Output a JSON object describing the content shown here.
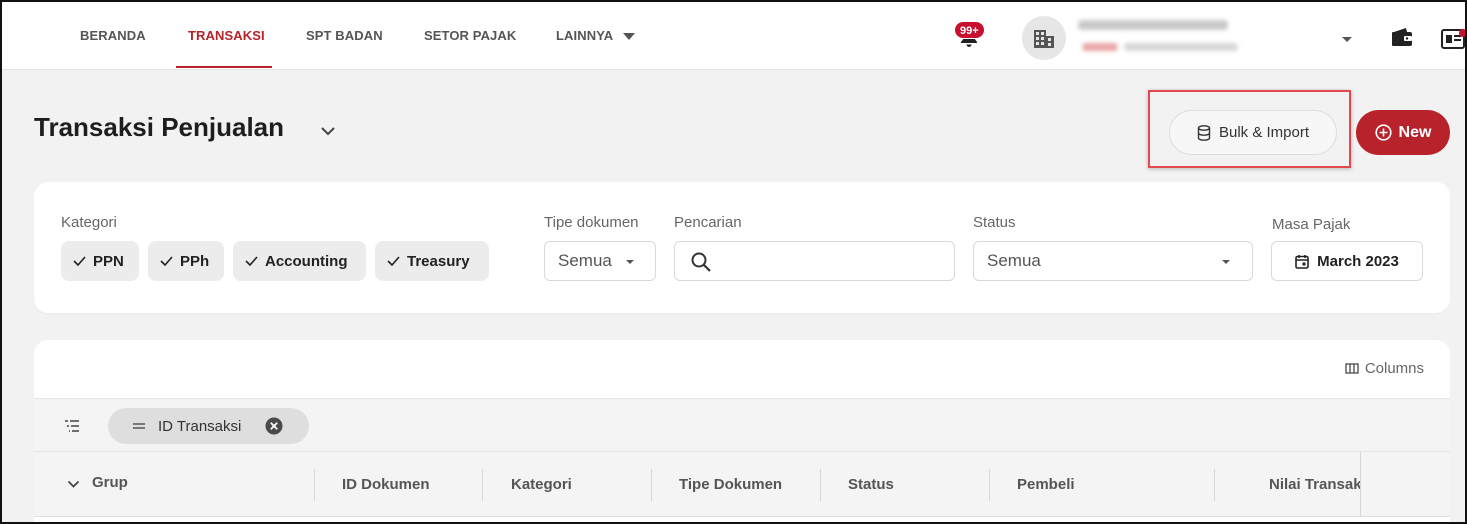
{
  "nav": {
    "items": [
      "BERANDA",
      "TRANSAKSI",
      "SPT BADAN",
      "SETOR PAJAK",
      "LAINNYA"
    ],
    "active": "TRANSAKSI",
    "notification_badge": "99+"
  },
  "page": {
    "title": "Transaksi Penjualan",
    "bulk_import_label": "Bulk & Import",
    "new_label": "New"
  },
  "filters": {
    "kategori_label": "Kategori",
    "kategori_chips": [
      "PPN",
      "PPh",
      "Accounting",
      "Treasury"
    ],
    "tipe_dokumen_label": "Tipe dokumen",
    "tipe_dokumen_value": "Semua",
    "pencarian_label": "Pencarian",
    "pencarian_value": "",
    "status_label": "Status",
    "status_value": "Semua",
    "masa_pajak_label": "Masa Pajak",
    "masa_pajak_value": "March 2023"
  },
  "table": {
    "columns_label": "Columns",
    "group_chip": "ID Transaksi",
    "headers": [
      "Grup",
      "ID Dokumen",
      "Kategori",
      "Tipe Dokumen",
      "Status",
      "Pembeli",
      "Nilai Transaksi"
    ]
  },
  "colors": {
    "brand": "#b8222a",
    "badge": "#c8102e",
    "highlight_border": "#e0494f"
  },
  "icons": [
    "bell-icon",
    "building-icon",
    "wallet-icon",
    "document-icon",
    "database-icon",
    "plus-circle-icon",
    "check-icon",
    "search-icon",
    "calendar-icon",
    "columns-icon",
    "group-list-icon",
    "drag-handle-icon",
    "close-circle-icon",
    "chevron-down-icon"
  ]
}
